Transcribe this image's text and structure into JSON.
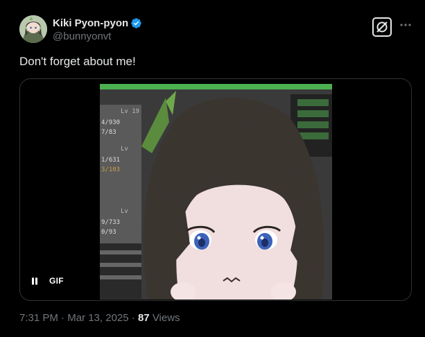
{
  "author": {
    "display_name": "Kiki Pyon-pyon",
    "handle": "@bunnyonvt",
    "verified_icon": "verified-badge-icon",
    "avatar": "avatar"
  },
  "actions": {
    "grok_icon": "grok-icon",
    "more_icon": "more-horizontal-icon"
  },
  "tweet": {
    "text": "Don't forget about me!"
  },
  "media": {
    "type_label": "GIF",
    "pause_icon": "pause-icon",
    "frame_text": {
      "lv1": "Lv 19",
      "hp1": "4/930",
      "mp1": "7/83",
      "lv2": "Lv",
      "hp2": "1/631",
      "mp2": "3/103",
      "lv3": "Lv",
      "hp3": "9/733",
      "mp3": "0/93"
    }
  },
  "meta": {
    "time": "7:31 PM",
    "separator1": "·",
    "date": "Mar 13, 2025",
    "separator2": "·",
    "views_count": "87",
    "views_label": "Views"
  },
  "colors": {
    "background": "#000000",
    "text_primary": "#e7e9ea",
    "text_secondary": "#71767b",
    "verified": "#1d9bf0",
    "border": "#2f3336"
  }
}
